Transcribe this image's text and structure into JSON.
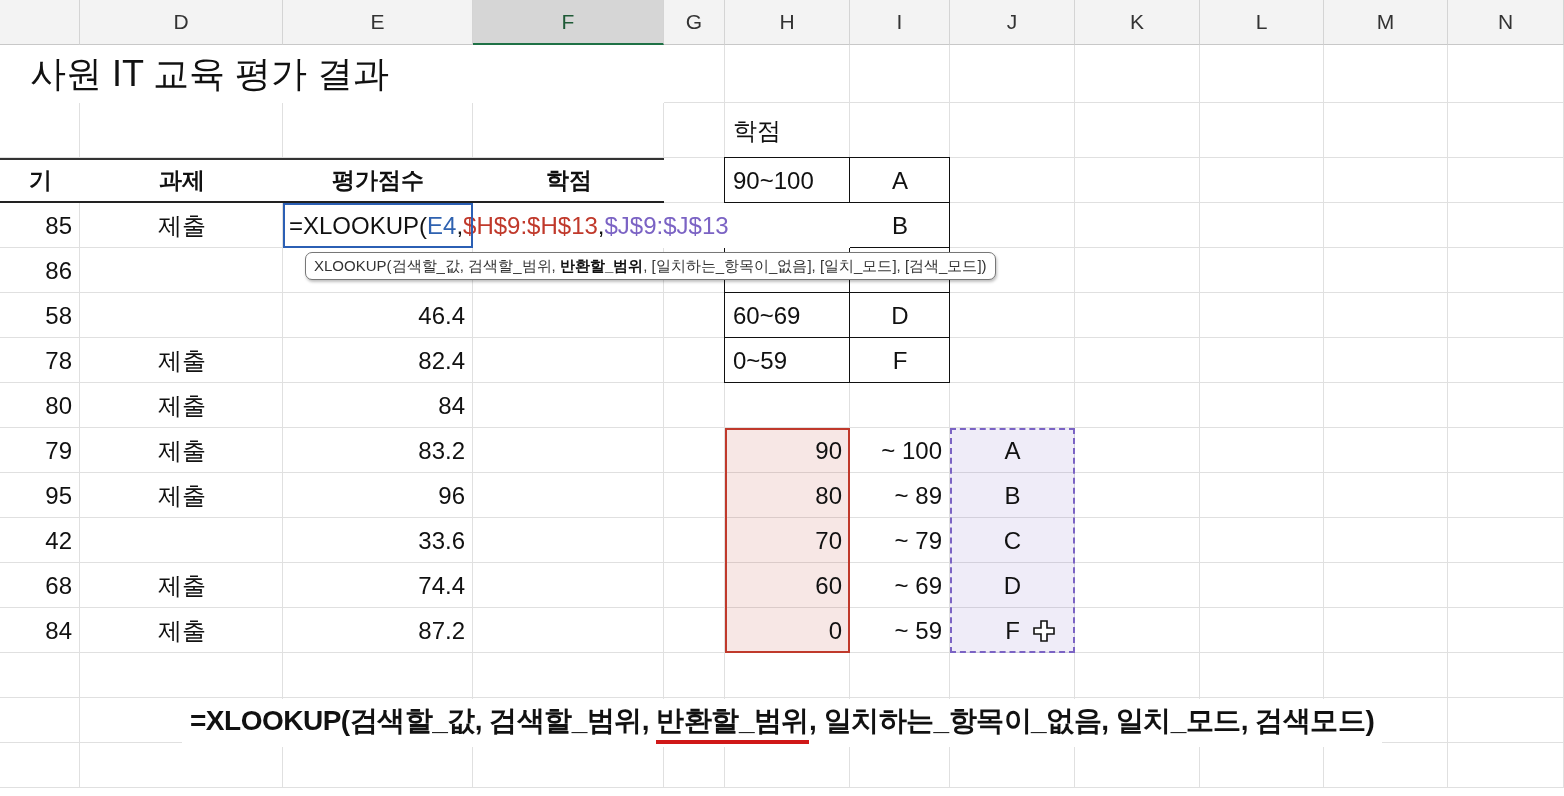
{
  "column_headers": [
    {
      "selected": false
    },
    {
      "label": "D",
      "selected": false
    },
    {
      "label": "E",
      "selected": false
    },
    {
      "label": "F",
      "selected": true
    },
    {
      "label": "G",
      "selected": false
    },
    {
      "label": "H",
      "selected": false
    },
    {
      "label": "I",
      "selected": false
    },
    {
      "label": "J",
      "selected": false
    },
    {
      "label": "K",
      "selected": false
    },
    {
      "label": "L",
      "selected": false
    },
    {
      "label": "M",
      "selected": false
    },
    {
      "label": "N",
      "selected": false
    }
  ],
  "title": "사원 IT 교육 평가 결과",
  "score_table": {
    "headers": [
      "기",
      "과제",
      "평가점수",
      "학점"
    ],
    "rows": [
      {
        "column_1": "85",
        "task": "제출"
      },
      {
        "column_1": "86"
      },
      {
        "column_1": "58",
        "score": "46.4"
      },
      {
        "column_1": "78",
        "task": "제출",
        "score": "82.4"
      },
      {
        "column_1": "80",
        "task": "제출",
        "score": "84"
      },
      {
        "column_1": "79",
        "task": "제출",
        "score": "83.2"
      },
      {
        "column_1": "95",
        "task": "제출",
        "score": "96"
      },
      {
        "column_1": "42",
        "score": "33.6"
      },
      {
        "column_1": "68",
        "task": "제출",
        "score": "74.4"
      },
      {
        "column_1": "84",
        "task": "제출",
        "score": "87.2"
      }
    ]
  },
  "formula_input": {
    "parts": [
      {
        "text": "=XLOOKUP(",
        "color": "#111111"
      },
      {
        "text": "E4",
        "color": "#2f62b0"
      },
      {
        "text": ",",
        "color": "#111111"
      },
      {
        "text": "$H$9:$H$13",
        "color": "#c0392b"
      },
      {
        "text": ",",
        "color": "#111111"
      },
      {
        "text": "$J$9:$J$13",
        "color": "#7b63c4"
      }
    ]
  },
  "function_tooltip": "XLOOKUP(검색할_값, 검색할_범위, **반환할_범위**, [일치하는_항목이_없음], [일치_모드], [검색_모드])",
  "grade_table": {
    "title": "학점",
    "rows": [
      {
        "range": "90~100",
        "grade": "A"
      },
      {
        "range": null,
        "grade": "B"
      },
      {
        "range": null,
        "grade": null
      },
      {
        "range": "60~69",
        "grade": "D"
      },
      {
        "range": "0~59",
        "grade": "F"
      }
    ]
  },
  "lookup_table": {
    "min_column": {
      "color": "#c0392b"
    },
    "grade_column": {
      "color": "#7b63c4"
    },
    "rows": [
      {
        "min": "90",
        "max": "~ 100",
        "grade": "A"
      },
      {
        "min": "80",
        "max": "~ 89",
        "grade": "B"
      },
      {
        "min": "70",
        "max": "~ 79",
        "grade": "C"
      },
      {
        "min": "60",
        "max": "~ 69",
        "grade": "D"
      },
      {
        "min": "0",
        "max": "~ 59",
        "grade": "F"
      }
    ]
  },
  "caption": {
    "parts": [
      {
        "text": "=XLOOKUP(검색할_값, 검색할_범위, ",
        "underlined": false
      },
      {
        "text": "반환할_범위",
        "underlined": true
      },
      {
        "text": ", 일치하는_항목이_없음, 일치_모드, 검색모드)",
        "underlined": false
      }
    ]
  }
}
